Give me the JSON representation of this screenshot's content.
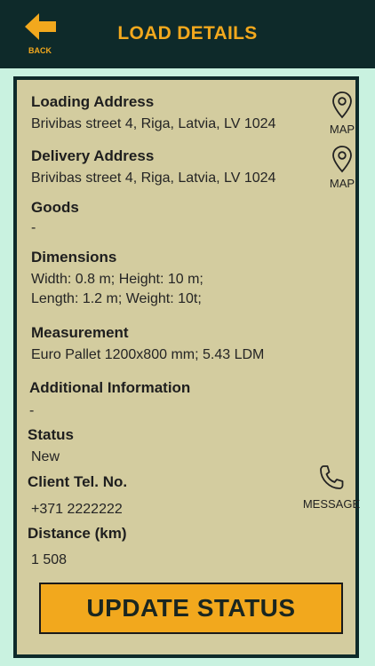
{
  "header": {
    "title": "LOAD DETAILS",
    "back_label": "BACK"
  },
  "colors": {
    "background": "#c9f2e0",
    "header": "#0e2a2a",
    "card": "#d3cc9f",
    "accent": "#f2a81d"
  },
  "loading": {
    "label": "Loading Address",
    "value": "Brivibas street 4, Riga, Latvia, LV 1024",
    "map_label": "MAP",
    "icon": "map-pin-icon"
  },
  "delivery": {
    "label": "Delivery Address",
    "value": "Brivibas street 4, Riga, Latvia, LV 1024",
    "map_label": "MAP",
    "icon": "map-pin-icon"
  },
  "goods": {
    "label": "Goods",
    "value": "-"
  },
  "dimensions": {
    "label": "Dimensions",
    "line1": "Width: 0.8 m; Height: 10 m;",
    "line2": "Length: 1.2 m; Weight: 10t;"
  },
  "measurement": {
    "label": "Measurement",
    "value": "Euro Pallet 1200x800 mm; 5.43 LDM"
  },
  "additional": {
    "label": "Additional Information",
    "value": "-"
  },
  "status": {
    "label": "Status",
    "value": "New"
  },
  "client_tel": {
    "label": "Client Tel. No.",
    "value": "+371 2222222",
    "message_label": "MESSAGE",
    "icon": "phone-icon"
  },
  "distance": {
    "label": "Distance (km)",
    "value": "1 508"
  },
  "actions": {
    "update_status": "UPDATE STATUS"
  }
}
